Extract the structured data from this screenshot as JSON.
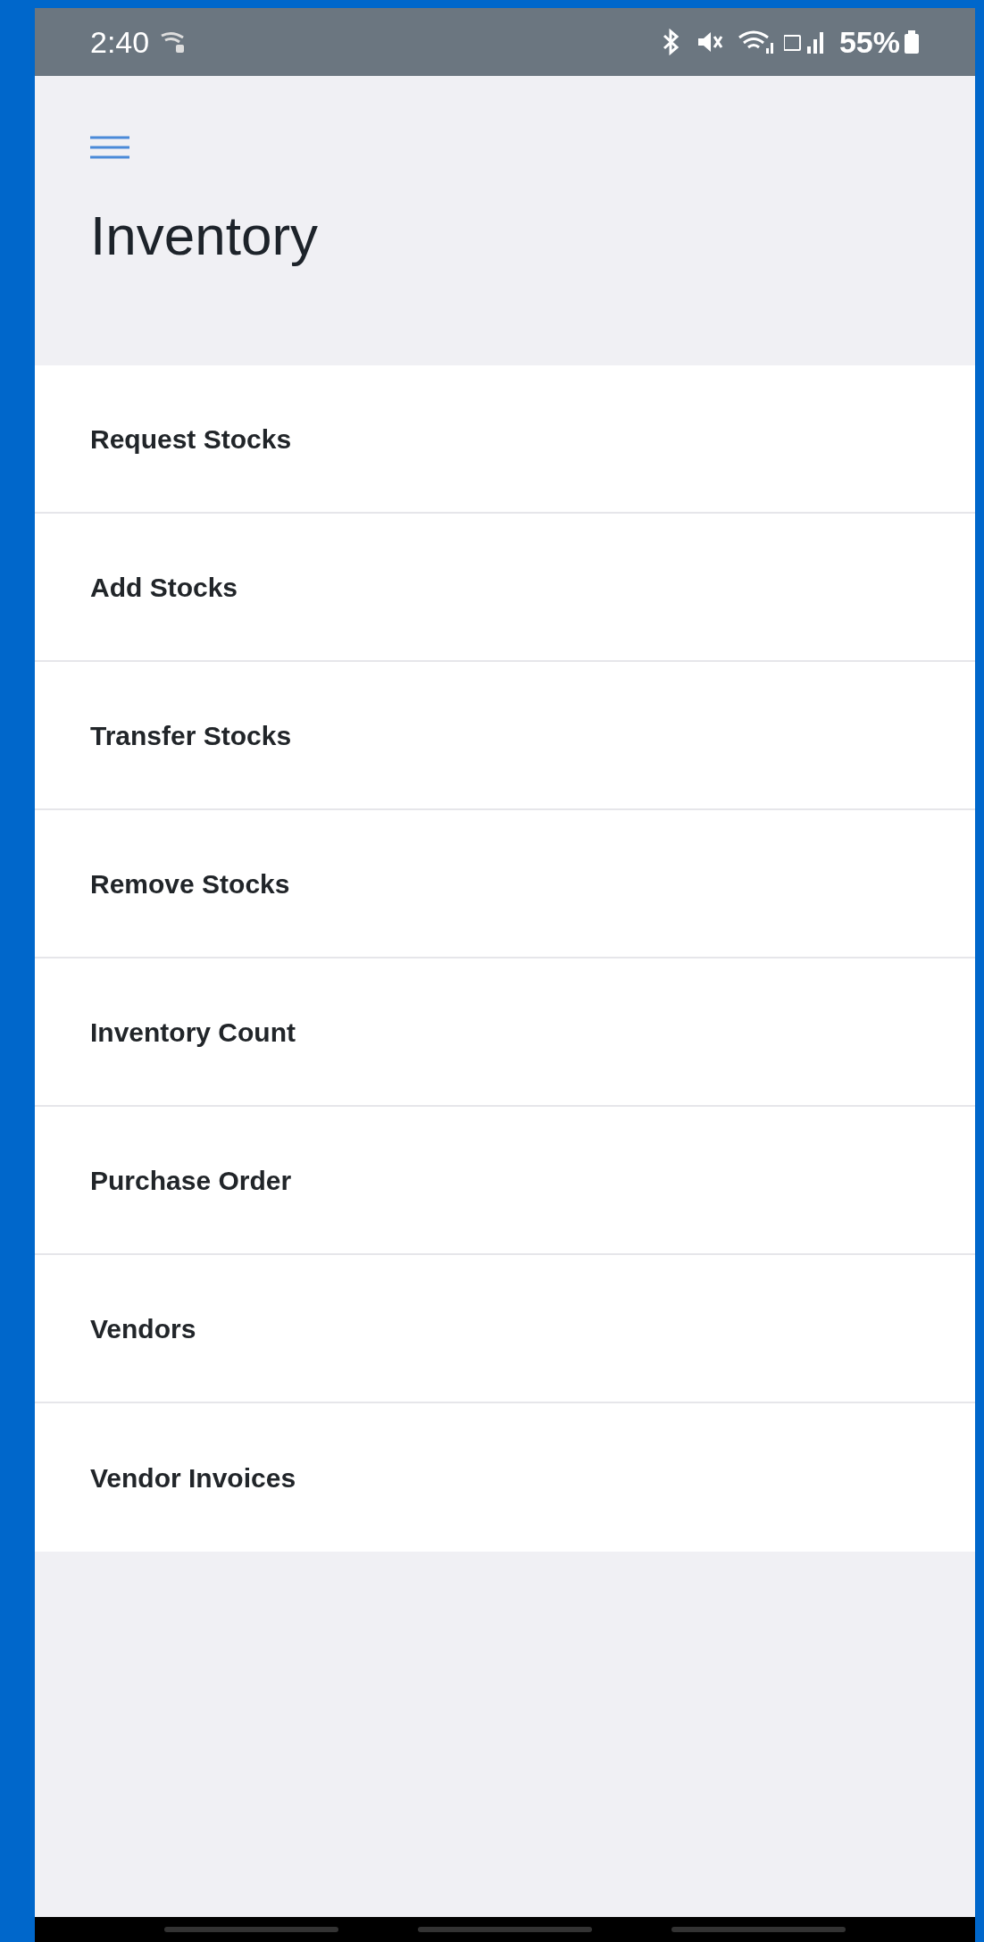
{
  "status_bar": {
    "time": "2:40",
    "battery": "55%"
  },
  "header": {
    "title": "Inventory"
  },
  "menu_items": [
    {
      "label": "Request Stocks"
    },
    {
      "label": "Add Stocks"
    },
    {
      "label": "Transfer Stocks"
    },
    {
      "label": "Remove Stocks"
    },
    {
      "label": "Inventory Count"
    },
    {
      "label": "Purchase Order"
    },
    {
      "label": "Vendors"
    },
    {
      "label": "Vendor Invoices"
    }
  ]
}
